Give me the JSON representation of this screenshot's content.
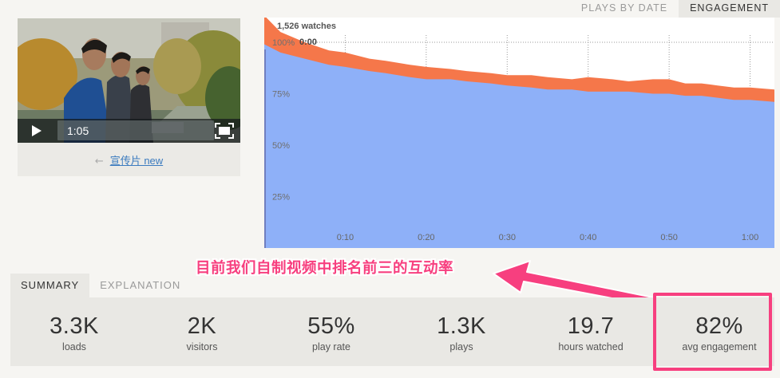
{
  "top_tabs": {
    "plays_by_date": "PLAYS BY DATE",
    "engagement": "ENGAGEMENT"
  },
  "video": {
    "current_time": "1:05",
    "back_arrow": "←",
    "title": "宣传片 new",
    "link_color": "#3b7bbf"
  },
  "chart_data": {
    "type": "area",
    "watches_label": "1,526 watches",
    "start_label": "0:00",
    "x": [
      0,
      2,
      5,
      8,
      10,
      13,
      15,
      18,
      20,
      23,
      25,
      28,
      30,
      33,
      35,
      38,
      40,
      43,
      45,
      48,
      50,
      52,
      54,
      56,
      58,
      60,
      63
    ],
    "xticks": [
      "0:10",
      "0:20",
      "0:30",
      "0:40",
      "0:50",
      "1:00"
    ],
    "xtick_values": [
      10,
      20,
      30,
      40,
      50,
      60
    ],
    "yticks": [
      "25%",
      "50%",
      "75%",
      "100%"
    ],
    "ytick_values": [
      25,
      50,
      75,
      100
    ],
    "ylim": [
      0,
      112
    ],
    "xlim": [
      0,
      63
    ],
    "series": [
      {
        "values": [
          113,
          105,
          100,
          96,
          95,
          92,
          91,
          89,
          88,
          87,
          86,
          85,
          84,
          84,
          83,
          82,
          83,
          82,
          81,
          82,
          82,
          80,
          80,
          79,
          78,
          78,
          77
        ],
        "color": "#f5774a"
      },
      {
        "values": [
          99,
          95,
          92,
          89,
          88,
          86,
          85,
          83,
          82,
          82,
          81,
          80,
          79,
          78,
          77,
          77,
          76,
          76,
          76,
          75,
          75,
          74,
          74,
          73,
          72,
          72,
          71
        ],
        "color": "#8eb0f8"
      }
    ]
  },
  "summary_tabs": {
    "summary": "SUMMARY",
    "explanation": "EXPLANATION"
  },
  "stats": [
    {
      "value": "3.3K",
      "label": "loads"
    },
    {
      "value": "2K",
      "label": "visitors"
    },
    {
      "value": "55%",
      "label": "play rate"
    },
    {
      "value": "1.3K",
      "label": "plays"
    },
    {
      "value": "19.7",
      "label": "hours watched"
    },
    {
      "value": "82%",
      "label": "avg engagement"
    }
  ],
  "annotation": {
    "text": "目前我们自制视频中排名前三的互动率",
    "color": "#f73f7f"
  }
}
